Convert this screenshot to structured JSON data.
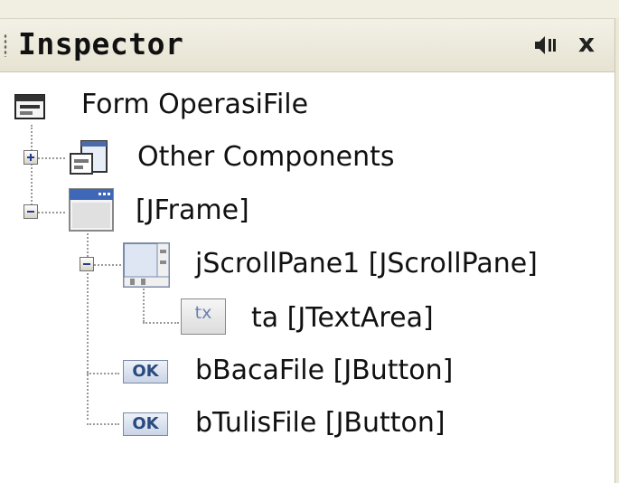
{
  "panel": {
    "title": "Inspector",
    "buttons": {
      "speaker_icon": "speaker-icon",
      "close_icon": "close-icon",
      "close_glyph": "x"
    }
  },
  "tree": {
    "root": "Form OperasiFile",
    "other_components": "Other Components",
    "jframe": "[JFrame]",
    "scrollpane": "jScrollPane1 [JScrollPane]",
    "textarea": "ta [JTextArea]",
    "button1": "bBacaFile [JButton]",
    "button2": "bTulisFile [JButton]"
  },
  "icons": {
    "ok_label": "OK",
    "tx_label": "tx"
  },
  "colors": {
    "titlebar": "#e6e3d2",
    "panel_bg": "#ffffff",
    "icon_blue": "#2a4a80"
  }
}
